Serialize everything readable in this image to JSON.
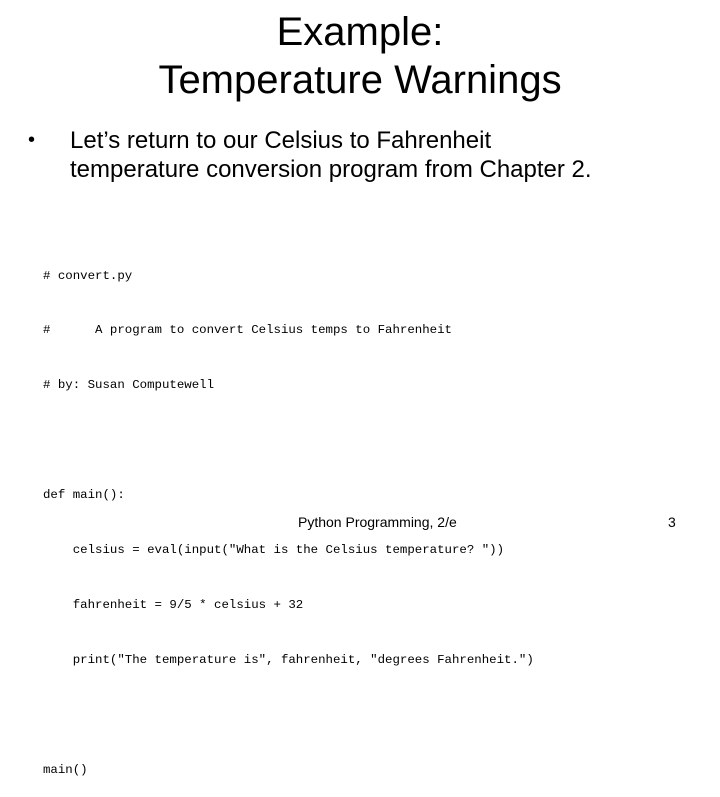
{
  "slide": {
    "title_line1": "Example:",
    "title_line2": "Temperature Warnings",
    "bullet_symbol": "•",
    "bullet_text_line1": "Let’s return to our Celsius to Fahrenheit",
    "bullet_text_line2": "temperature conversion program from Chapter 2.",
    "code_lines": [
      "# convert.py",
      "#      A program to convert Celsius temps to Fahrenheit",
      "# by: Susan Computewell",
      "",
      "def main():",
      "    celsius = eval(input(\"What is the Celsius temperature? \"))",
      "    fahrenheit = 9/5 * celsius + 32",
      "    print(\"The temperature is\", fahrenheit, \"degrees Fahrenheit.\")",
      "",
      "main()"
    ],
    "footer": {
      "book": "Python Programming, 2/e",
      "page_number": "3"
    }
  }
}
